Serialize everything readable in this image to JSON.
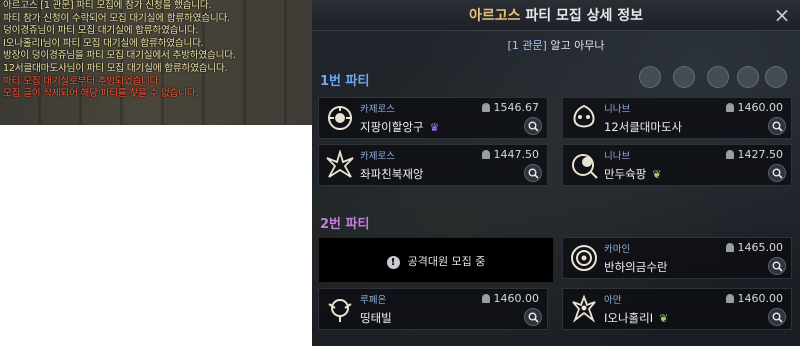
{
  "chat": {
    "lines": [
      {
        "text": "아르고스  [1 관문] 파티 모집에 참가 신청을 했습니다.",
        "color": "#f2e7a8"
      },
      {
        "text": "파티 참가 신청이 수락되어 모집 대기실에 합류하였습니다.",
        "color": "#f2e7a8"
      },
      {
        "text": "덩이경쥬님이 파티 모집 대기실에 합류하였습니다.",
        "color": "#f2e7a8"
      },
      {
        "text": "I오나홀리I님이 파티 모집 대기실에 합류하였습니다.",
        "color": "#f2e7a8"
      },
      {
        "text": "방장이 덩이경쥬님을 파티 모집 대기실에서 추방하였습니다.",
        "color": "#f2e7a8"
      },
      {
        "text": "12서클대마도사님이 파티 모집 대기실에 합류하였습니다.",
        "color": "#f2e7a8"
      },
      {
        "text": "파티 모집 대기실로부터 추방되었습니다.",
        "color": "#ff5a3c"
      },
      {
        "text": "모집 글이 삭제되어 해당 파티를 찾을 수 없습니다.",
        "color": "#ff5a3c"
      }
    ]
  },
  "panel": {
    "title_accent": "아르고스",
    "title_rest": " 파티 모집 상세 정보",
    "close_label": "×",
    "subtitle_channel": "[1 관문]",
    "subtitle_text": " 알고 아무나",
    "party1_label": "1번 파티",
    "party2_label": "2번 파티",
    "recruiting_text": "공격대원 모집 중",
    "info_glyph": "!"
  },
  "members": [
    {
      "class": "카제로스",
      "name": "지팡이할앙구",
      "gear": "1546.67",
      "badge": "♛",
      "badge_type": "crown"
    },
    {
      "class": "니나브",
      "name": "12서클대마도사",
      "gear": "1460.00",
      "badge": "",
      "badge_type": ""
    },
    {
      "class": "카제로스",
      "name": "좌파친북재앙",
      "gear": "1447.50",
      "badge": "",
      "badge_type": ""
    },
    {
      "class": "니나브",
      "name": "만두슉팡",
      "gear": "1427.50",
      "badge": "❦",
      "badge_type": "sprout"
    },
    {
      "class": "카마인",
      "name": "반하의금수란",
      "gear": "1465.00",
      "badge": "",
      "badge_type": ""
    },
    {
      "class": "루페온",
      "name": "띵태빌",
      "gear": "1460.00",
      "badge": "",
      "badge_type": ""
    },
    {
      "class": "아만",
      "name": "I오나홀리I",
      "gear": "1460.00",
      "badge": "❦",
      "badge_type": "sprout"
    }
  ],
  "icons": {
    "emblem": "emblem-icon",
    "helmet": "helmet-icon",
    "search": "search-icon"
  },
  "colors": {
    "chat_default": "#f2e7a8",
    "chat_error": "#ff5a3c",
    "party1": "#6fa8f2",
    "party2": "#c67ee0",
    "title_accent": "#e7c37a"
  }
}
